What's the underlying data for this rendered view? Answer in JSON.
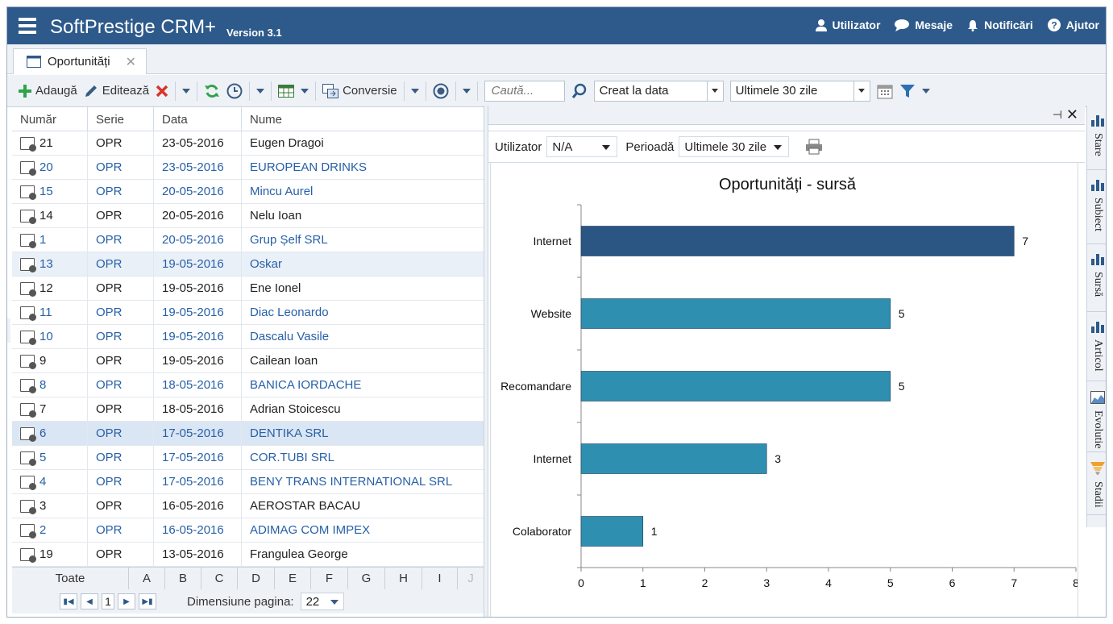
{
  "app": {
    "title": "SoftPrestige CRM+",
    "version": "Version 3.1"
  },
  "topnav": [
    {
      "label": "Utilizator",
      "icon": "user-icon"
    },
    {
      "label": "Mesaje",
      "icon": "chat-icon"
    },
    {
      "label": "Notificări",
      "icon": "bell-icon"
    },
    {
      "label": "Ajutor",
      "icon": "help-icon"
    }
  ],
  "tab": {
    "label": "Oportunități"
  },
  "toolbar": {
    "add": "Adaugă",
    "edit": "Editează",
    "convert": "Conversie",
    "search_placeholder": "Caută...",
    "date_field": "Creat la data",
    "period": "Ultimele 30 zile"
  },
  "grid": {
    "headers": [
      "Număr",
      "Serie",
      "Data",
      "Nume"
    ],
    "rows": [
      {
        "nr": "21",
        "serie": "OPR",
        "data": "23-05-2016",
        "nume": "Eugen Dragoi",
        "style": ""
      },
      {
        "nr": "20",
        "serie": "OPR",
        "data": "23-05-2016",
        "nume": "EUROPEAN DRINKS",
        "style": "blue"
      },
      {
        "nr": "15",
        "serie": "OPR",
        "data": "20-05-2016",
        "nume": "Mincu Aurel",
        "style": "blue"
      },
      {
        "nr": "14",
        "serie": "OPR",
        "data": "20-05-2016",
        "nume": "Nelu Ioan",
        "style": ""
      },
      {
        "nr": "1",
        "serie": "OPR",
        "data": "20-05-2016",
        "nume": "Grup Șelf SRL",
        "style": "blue"
      },
      {
        "nr": "13",
        "serie": "OPR",
        "data": "19-05-2016",
        "nume": "Oskar",
        "style": "blue sel1"
      },
      {
        "nr": "12",
        "serie": "OPR",
        "data": "19-05-2016",
        "nume": "Ene Ionel",
        "style": ""
      },
      {
        "nr": "11",
        "serie": "OPR",
        "data": "19-05-2016",
        "nume": "Diac Leonardo",
        "style": "blue"
      },
      {
        "nr": "10",
        "serie": "OPR",
        "data": "19-05-2016",
        "nume": "Dascalu Vasile",
        "style": "blue"
      },
      {
        "nr": "9",
        "serie": "OPR",
        "data": "19-05-2016",
        "nume": "Cailean Ioan",
        "style": ""
      },
      {
        "nr": "8",
        "serie": "OPR",
        "data": "18-05-2016",
        "nume": "BANICA IORDACHE",
        "style": "blue"
      },
      {
        "nr": "7",
        "serie": "OPR",
        "data": "18-05-2016",
        "nume": "Adrian Stoicescu",
        "style": ""
      },
      {
        "nr": "6",
        "serie": "OPR",
        "data": "17-05-2016",
        "nume": "DENTIKA SRL",
        "style": "blue sel2"
      },
      {
        "nr": "5",
        "serie": "OPR",
        "data": "17-05-2016",
        "nume": "COR.TUBI SRL",
        "style": "blue"
      },
      {
        "nr": "4",
        "serie": "OPR",
        "data": "17-05-2016",
        "nume": "BENY TRANS INTERNATIONAL SRL",
        "style": "blue"
      },
      {
        "nr": "3",
        "serie": "OPR",
        "data": "16-05-2016",
        "nume": "AEROSTAR BACAU",
        "style": ""
      },
      {
        "nr": "2",
        "serie": "OPR",
        "data": "16-05-2016",
        "nume": "ADIMAG COM IMPEX",
        "style": "blue"
      },
      {
        "nr": "19",
        "serie": "OPR",
        "data": "13-05-2016",
        "nume": "Frangulea George",
        "style": ""
      }
    ],
    "alpha": [
      "Toate",
      "A",
      "B",
      "C",
      "D",
      "E",
      "F",
      "G",
      "H",
      "I",
      "J"
    ],
    "pager": {
      "page": "1",
      "size_label": "Dimensiune pagina:",
      "size": "22"
    }
  },
  "chart_panel": {
    "user_label": "Utilizator",
    "user_value": "N/A",
    "period_label": "Perioadă",
    "period_value": "Ultimele 30 zile"
  },
  "side_tabs": [
    "Stare",
    "Subiect",
    "Sursă",
    "Articol",
    "Evolutie",
    "Stadii"
  ],
  "chart_data": {
    "type": "bar",
    "orientation": "horizontal",
    "title": "Oportunități - sursă",
    "categories": [
      "Internet",
      "Website",
      "Recomandare",
      "Internet",
      "Colaborator"
    ],
    "values": [
      7,
      5,
      5,
      3,
      1
    ],
    "colors": [
      "#2b5583",
      "#2f8fb0",
      "#2f8fb0",
      "#2f8fb0",
      "#2f8fb0"
    ],
    "xlim": [
      0,
      8
    ],
    "xticks": [
      "0",
      "1",
      "2",
      "3",
      "4",
      "5",
      "6",
      "7",
      "8"
    ],
    "grid": false,
    "legend": "none"
  },
  "colors": {
    "header": "#2d5a8a",
    "link": "#2760a8",
    "accent_green": "#2fa34a",
    "accent_red": "#d9342b"
  }
}
